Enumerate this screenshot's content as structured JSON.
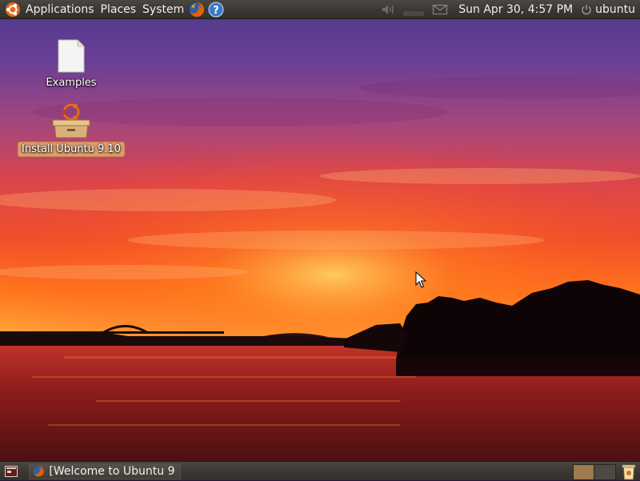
{
  "top_panel": {
    "menus": {
      "applications": "Applications",
      "places": "Places",
      "system": "System"
    },
    "launchers": [
      {
        "icon": "firefox-icon",
        "color": "#e66000"
      },
      {
        "icon": "help-icon",
        "color": "#3a78c9"
      }
    ],
    "tray_icons": [
      "volume-icon",
      "network-icon",
      "mail-icon"
    ],
    "clock": "Sun Apr 30,  4:57 PM",
    "user": "ubuntu",
    "user_icon": "power-icon"
  },
  "desktop": {
    "icons": [
      {
        "label": "Examples",
        "icon": "file-icon",
        "selected": false
      },
      {
        "label": "Install Ubuntu 9.10",
        "icon": "installer-icon",
        "selected": true
      }
    ],
    "wallpaper": "sunset-harbour-bridge"
  },
  "bottom_panel": {
    "show_desktop_icon": "show-desktop-icon",
    "tasks": [
      {
        "label": "[Welcome to Ubuntu 9....",
        "icon": "firefox-icon"
      }
    ],
    "workspaces": [
      "workspace-1",
      "workspace-2"
    ],
    "trash_icon": "trash-icon"
  },
  "colors": {
    "panel": "#3a3632",
    "panel_text": "#f2efe9",
    "selection": "#e2aa6e",
    "sky_top": "#5b3a8c",
    "sky_horizon": "#ff6a1a",
    "water": "#8a1f1a"
  }
}
